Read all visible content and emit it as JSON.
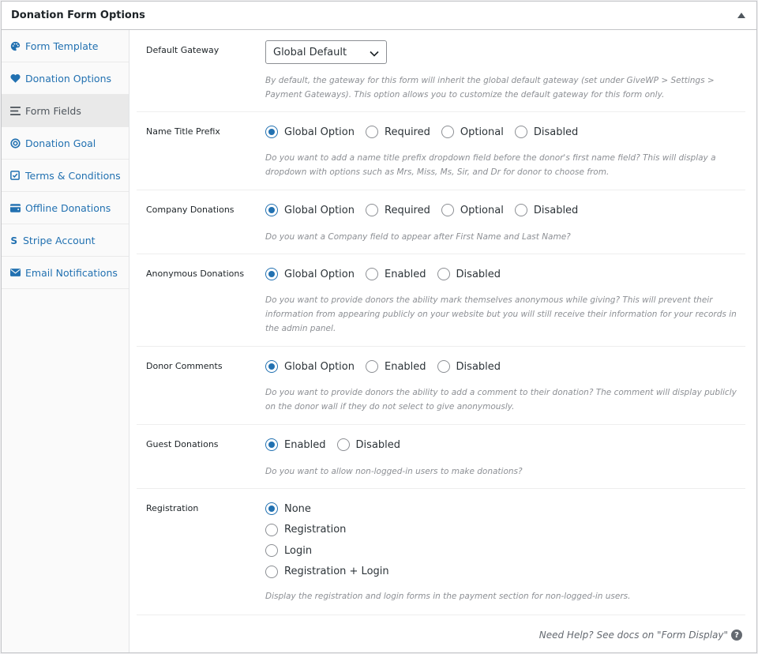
{
  "panel": {
    "title": "Donation Form Options"
  },
  "sidebar": {
    "items": [
      {
        "label": "Form Template",
        "icon": "palette-icon",
        "active": false
      },
      {
        "label": "Donation Options",
        "icon": "heart-icon",
        "active": false
      },
      {
        "label": "Form Fields",
        "icon": "lines-icon",
        "active": true
      },
      {
        "label": "Donation Goal",
        "icon": "target-icon",
        "active": false
      },
      {
        "label": "Terms & Conditions",
        "icon": "checkbox-icon",
        "active": false
      },
      {
        "label": "Offline Donations",
        "icon": "wallet-icon",
        "active": false
      },
      {
        "label": "Stripe Account",
        "icon": "stripe-s-icon",
        "active": false
      },
      {
        "label": "Email Notifications",
        "icon": "envelope-icon",
        "active": false
      }
    ]
  },
  "fields": {
    "default_gateway": {
      "label": "Default Gateway",
      "value": "Global Default",
      "description": "By default, the gateway for this form will inherit the global default gateway (set under GiveWP > Settings > Payment Gateways). This option allows you to customize the default gateway for this form only."
    },
    "name_title_prefix": {
      "label": "Name Title Prefix",
      "options": [
        "Global Option",
        "Required",
        "Optional",
        "Disabled"
      ],
      "selected": "Global Option",
      "description": "Do you want to add a name title prefix dropdown field before the donor's first name field? This will display a dropdown with options such as Mrs, Miss, Ms, Sir, and Dr for donor to choose from."
    },
    "company_donations": {
      "label": "Company Donations",
      "options": [
        "Global Option",
        "Required",
        "Optional",
        "Disabled"
      ],
      "selected": "Global Option",
      "description": "Do you want a Company field to appear after First Name and Last Name?"
    },
    "anonymous_donations": {
      "label": "Anonymous Donations",
      "options": [
        "Global Option",
        "Enabled",
        "Disabled"
      ],
      "selected": "Global Option",
      "description": "Do you want to provide donors the ability mark themselves anonymous while giving? This will prevent their information from appearing publicly on your website but you will still receive their information for your records in the admin panel."
    },
    "donor_comments": {
      "label": "Donor Comments",
      "options": [
        "Global Option",
        "Enabled",
        "Disabled"
      ],
      "selected": "Global Option",
      "description": "Do you want to provide donors the ability to add a comment to their donation? The comment will display publicly on the donor wall if they do not select to give anonymously."
    },
    "guest_donations": {
      "label": "Guest Donations",
      "options": [
        "Enabled",
        "Disabled"
      ],
      "selected": "Enabled",
      "description": "Do you want to allow non-logged-in users to make donations?"
    },
    "registration": {
      "label": "Registration",
      "options": [
        "None",
        "Registration",
        "Login",
        "Registration + Login"
      ],
      "selected": "None",
      "description": "Display the registration and login forms in the payment section for non-logged-in users."
    }
  },
  "footer": {
    "help_text": "Need Help? See docs on \"Form Display\"",
    "help_icon": "question-icon"
  },
  "colors": {
    "accent": "#2271b1",
    "border": "#c3c4c7",
    "muted": "#8c8f94"
  }
}
